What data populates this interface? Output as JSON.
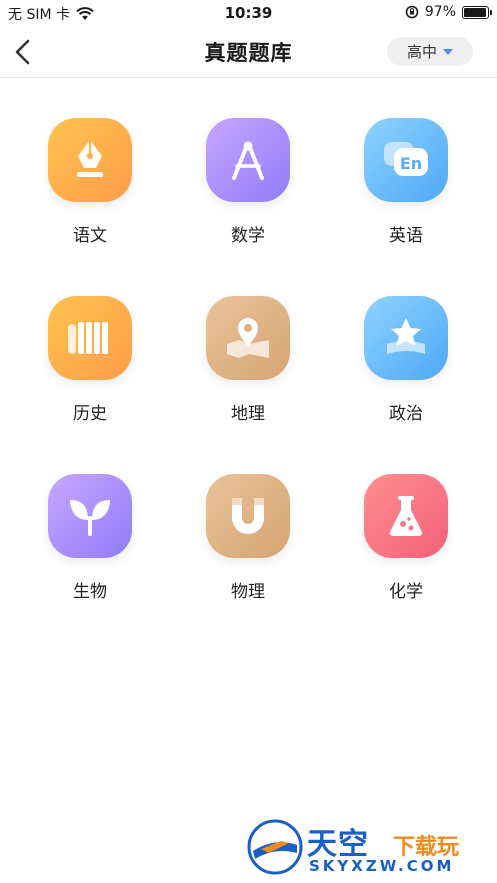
{
  "status_bar": {
    "carrier": "无 SIM 卡",
    "time": "10:39",
    "battery": "97%",
    "battery_level": 0.97
  },
  "nav": {
    "title": "真题题库",
    "level": "高中"
  },
  "subjects": [
    {
      "label": "语文",
      "icon": "pen-nib-icon",
      "color_a": "#ffc34d",
      "color_b": "#ff9d4a"
    },
    {
      "label": "数学",
      "icon": "compass-icon",
      "color_a": "#c8a6ff",
      "color_b": "#8f7cf7"
    },
    {
      "label": "英语",
      "icon": "english-speech-icon",
      "color_a": "#8fd3ff",
      "color_b": "#4da8f5"
    },
    {
      "label": "历史",
      "icon": "scroll-icon",
      "color_a": "#ffc34d",
      "color_b": "#ff9d4a"
    },
    {
      "label": "地理",
      "icon": "map-pin-icon",
      "color_a": "#e8c49a",
      "color_b": "#d6a472"
    },
    {
      "label": "政治",
      "icon": "star-icon",
      "color_a": "#8fd3ff",
      "color_b": "#4da8f5"
    },
    {
      "label": "生物",
      "icon": "sprout-icon",
      "color_a": "#c8a6ff",
      "color_b": "#8f7cf7"
    },
    {
      "label": "物理",
      "icon": "magnet-icon",
      "color_a": "#e8c49a",
      "color_b": "#d6a472"
    },
    {
      "label": "化学",
      "icon": "flask-icon",
      "color_a": "#ff8f8f",
      "color_b": "#f2607a"
    }
  ],
  "watermark": {
    "name": "天空",
    "name2": "下载玩",
    "domain": "SKYXZW.COM"
  }
}
